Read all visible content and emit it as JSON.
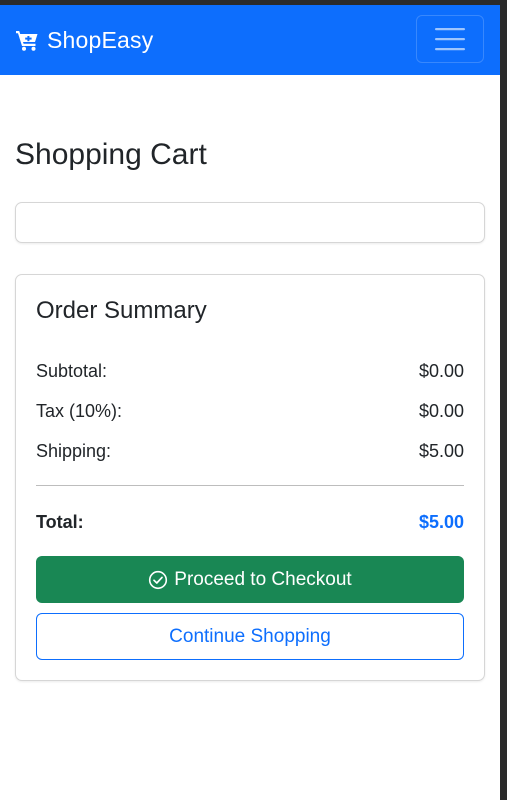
{
  "navbar": {
    "brand_text": "ShopEasy",
    "brand_icon": "shopping-cart-icon",
    "menu_icon": "hamburger-menu-icon",
    "background_color": "#0d6efd"
  },
  "page": {
    "title": "Shopping Cart"
  },
  "summary": {
    "title": "Order Summary",
    "subtotal_label": "Subtotal:",
    "subtotal_value": "$0.00",
    "tax_label": "Tax (10%):",
    "tax_value": "$0.00",
    "shipping_label": "Shipping:",
    "shipping_value": "$5.00",
    "total_label": "Total:",
    "total_value": "$5.00",
    "total_color": "#0d6efd"
  },
  "actions": {
    "checkout_label": "Proceed to Checkout",
    "checkout_icon": "check-circle-icon",
    "checkout_color": "#198754",
    "continue_label": "Continue Shopping"
  }
}
